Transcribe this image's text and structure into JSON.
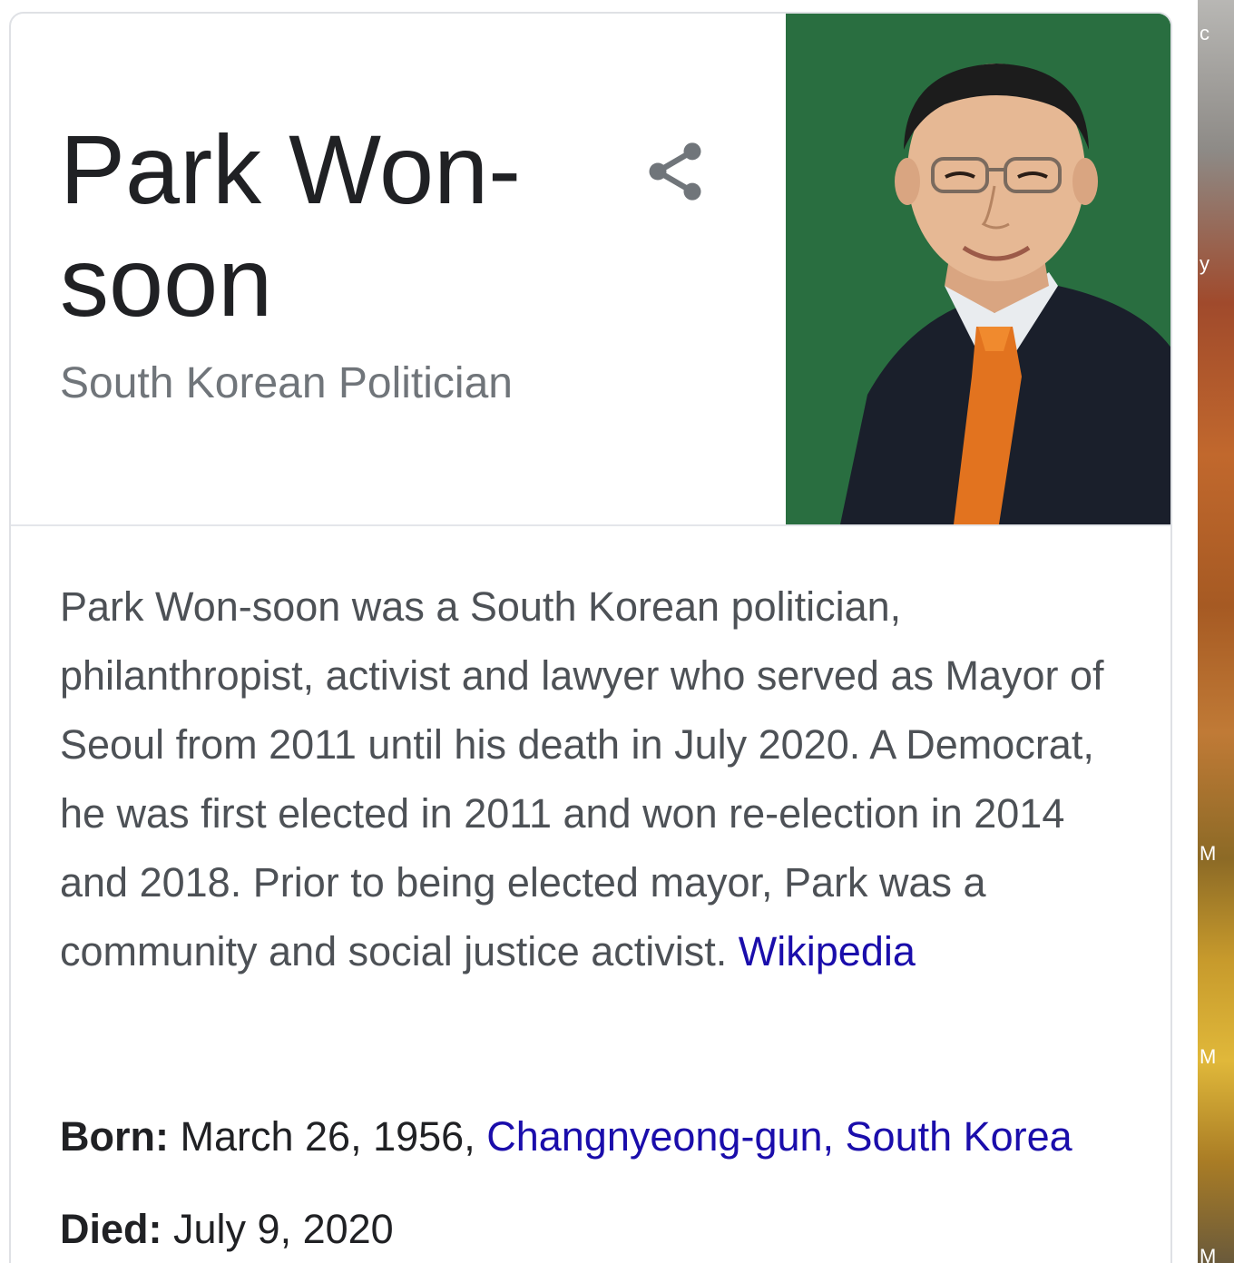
{
  "panel": {
    "title": "Park Won-soon",
    "subtitle": "South Korean Politician",
    "share_icon": "share-icon",
    "photo_icon": "portrait-photo"
  },
  "description": {
    "text": "Park Won-soon was a South Korean politician, philanthropist, activist and lawyer who served as Mayor of Seoul from 2011 until his death in July 2020. A Democrat, he was first elected in 2011 and won re-election in 2014 and 2018. Prior to being elected mayor, Park was a community and social justice activist.",
    "source_link": "Wikipedia"
  },
  "facts": {
    "born": {
      "label": "Born:",
      "value": "March 26, 1956,",
      "place_link": "Changnyeong-gun, South Korea"
    },
    "died": {
      "label": "Died:",
      "value": "July 9, 2020"
    }
  },
  "desktop_edge_letters": [
    "c",
    "y",
    "M",
    "M",
    "M"
  ],
  "colors": {
    "link": "#1a0dab",
    "title": "#202124",
    "subtitle": "#70757a",
    "body": "#4d5156",
    "photo_background": "#2d7445"
  }
}
